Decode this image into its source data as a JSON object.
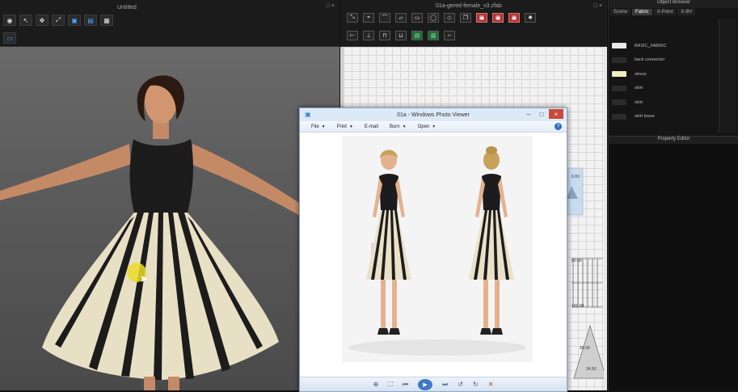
{
  "viewport": {
    "title": "Untitled",
    "winbtns": "□ ×"
  },
  "pattern": {
    "title": "01a-gered-female_v3.zfab",
    "winbtns": "□ ×",
    "labels": [
      "6.00",
      "80.00",
      "100.00",
      "90.00",
      "24.50"
    ]
  },
  "browser": {
    "title": "Object Browser",
    "tabs": [
      "Scene",
      "Fabric",
      "X-Point",
      "X-BV"
    ],
    "items": [
      {
        "label": "BASIC_FABRIC",
        "color": "#e8e8e8"
      },
      {
        "label": "back connector",
        "color": "#2b2b2b"
      },
      {
        "label": "stress",
        "color": "#f0edc2"
      },
      {
        "label": "skirt",
        "color": "#2b2b2b"
      },
      {
        "label": "skirt",
        "color": "#2b2b2b"
      },
      {
        "label": "skirt leave",
        "color": "#2b2b2b"
      }
    ],
    "property_editor_title": "Property Editor"
  },
  "photoviewer": {
    "title": "01a - Windows Photo Viewer",
    "menu": [
      {
        "label": "File"
      },
      {
        "label": "Print"
      },
      {
        "label": "E-mail"
      },
      {
        "label": "Burn"
      },
      {
        "label": "Open"
      }
    ],
    "help": "?",
    "controls": {
      "minimize": "–",
      "maximize": "□",
      "close": "×"
    }
  },
  "colors": {
    "dress_dark": "#1c1c1c",
    "dress_cream": "#e8e0c4",
    "skin": "#c98e6a",
    "accent_blue": "#4aa3ff"
  }
}
